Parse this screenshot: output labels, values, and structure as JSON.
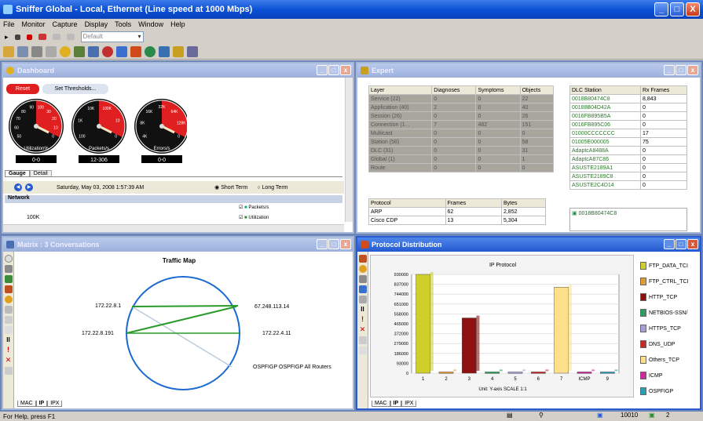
{
  "window": {
    "title": "Sniffer Global - Local, Ethernet (Line speed at 1000 Mbps)",
    "min": "_",
    "max": "□",
    "close": "X"
  },
  "menu": [
    "File",
    "Monitor",
    "Capture",
    "Display",
    "Tools",
    "Window",
    "Help"
  ],
  "toolbar": {
    "combo_value": "Default"
  },
  "dashboard": {
    "title": "Dashboard",
    "reset": "Reset",
    "set_thresholds": "Set Thresholds...",
    "gauges": [
      {
        "label": "Utilization%",
        "value": "0-0",
        "ticks": [
          "50",
          "60",
          "70",
          "80",
          "90",
          "100",
          "30",
          "20",
          "10",
          "0"
        ]
      },
      {
        "label": "Packets/s",
        "value": "12-306",
        "ticks": [
          "100",
          "1K",
          "10K",
          "100K",
          "10",
          "0"
        ]
      },
      {
        "label": "Errors/s",
        "value": "0-0",
        "ticks": [
          "4K",
          "8K",
          "16K",
          "32K",
          "64K",
          "128K",
          "0"
        ]
      }
    ],
    "tabs": [
      "Gauge",
      "Detail"
    ],
    "date": "Saturday, May 03, 2008 1:57:39 AM",
    "short_term": "Short Term",
    "long_term": "Long Term",
    "network_label": "Network",
    "y_value": "100K",
    "legend": [
      "Packets/s",
      "Utilization"
    ]
  },
  "expert": {
    "title": "Expert",
    "headers": [
      "Layer",
      "Diagnoses",
      "Symptoms",
      "Objects"
    ],
    "rows": [
      [
        "Service (22)",
        "0",
        "0",
        "22"
      ],
      [
        "Application (40)",
        "2",
        "0",
        "40"
      ],
      [
        "Session (26)",
        "0",
        "0",
        "26"
      ],
      [
        "Connection (1...",
        "7",
        "482",
        "151"
      ],
      [
        "Multicast",
        "0",
        "0",
        "0"
      ],
      [
        "Station (58)",
        "0",
        "0",
        "58"
      ],
      [
        "DLC (31)",
        "0",
        "0",
        "31"
      ],
      [
        "Global (1)",
        "0",
        "0",
        "1"
      ],
      [
        "Route",
        "0",
        "0",
        "0"
      ]
    ],
    "dlc_headers": [
      "DLC Station",
      "Rx Frames"
    ],
    "dlc_rows": [
      [
        "0018B80474C8",
        "8,843"
      ],
      [
        "00188B04D42A",
        "0"
      ],
      [
        "0016FB895B5A",
        "0"
      ],
      [
        "0016FB895C06",
        "0"
      ],
      [
        "01000CCCCCCC",
        "17"
      ],
      [
        "01005E000005",
        "75"
      ],
      [
        "AdaptcA8488A",
        "0"
      ],
      [
        "AdaptcA87C86",
        "0"
      ],
      [
        "ASUSTE2189A1",
        "0"
      ],
      [
        "ASUSTE2189C8",
        "0"
      ],
      [
        "ASUSTE2C4D14",
        "0"
      ]
    ],
    "proto_headers": [
      "Protocol",
      "Frames",
      "Bytes"
    ],
    "proto_rows": [
      [
        "ARP",
        "62",
        "2,852"
      ],
      [
        "Cisco CDP",
        "13",
        "5,304"
      ]
    ],
    "selected_station": "0018B80474C8"
  },
  "matrix": {
    "title": "Matrix : 3 Conversations",
    "map_title": "Traffic Map",
    "nodes": [
      "172.22.8.1",
      "172.22.8.191",
      "67.248.113.14",
      "172.22.4.11",
      "OSPFIGP OSPFIGP All Routers"
    ],
    "tabs": [
      "MAC",
      "IP",
      "IPX"
    ]
  },
  "protocol": {
    "title": "Protocol Distribution",
    "chart_tabs": [
      "MAC",
      "IP",
      "IPX"
    ]
  },
  "chart_data": {
    "type": "bar",
    "title": "IP Protocol",
    "xlabel": "Unit: Y-axis SCALE 1:1",
    "categories": [
      "1",
      "2",
      "3",
      "4",
      "5",
      "6",
      "7",
      "ICMP",
      "9"
    ],
    "values": [
      930000,
      12000,
      520000,
      12000,
      12000,
      12000,
      810000,
      12000,
      12000
    ],
    "colors": [
      "#cfcf2a",
      "#e39b3a",
      "#8e1010",
      "#2ca05a",
      "#a59ed8",
      "#c82828",
      "#ffe08a",
      "#d02a9a",
      "#2aa0b8"
    ],
    "ylim": [
      0,
      930000
    ],
    "yticks": [
      "930000",
      "837000",
      "744000",
      "651000",
      "558000",
      "465000",
      "372000",
      "279000",
      "186000",
      "93000",
      "0"
    ],
    "legend": [
      "FTP_DATA_TCI",
      "FTP_CTRL_TCI",
      "HTTP_TCP",
      "NETBIOS-SSN/",
      "HTTPS_TCP",
      "DNS_UDP",
      "Others_TCP",
      "ICMP",
      "OSPFIGP"
    ]
  },
  "status": {
    "help": "For Help, press F1",
    "count": "10010",
    "page": "2"
  }
}
